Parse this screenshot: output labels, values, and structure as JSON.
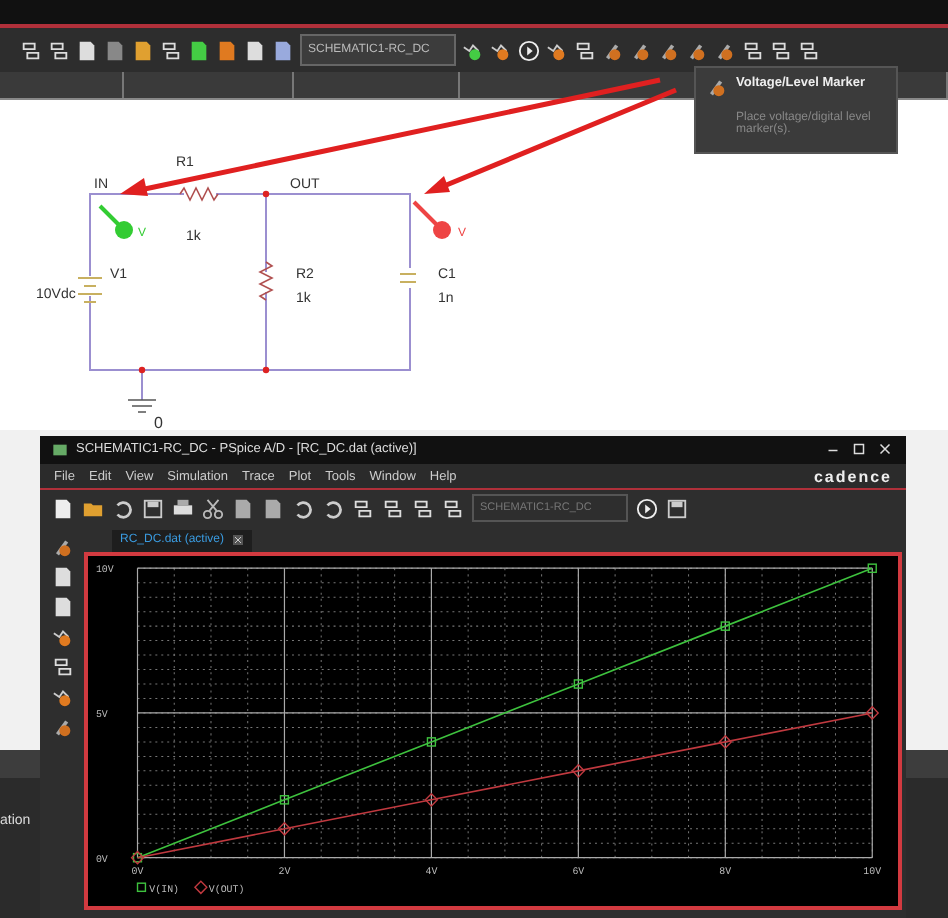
{
  "toolbar": {
    "design_select": "SCHEMATIC1-RC_DC"
  },
  "tooltip": {
    "title": "Voltage/Level Marker",
    "description": "Place voltage/digital level marker(s)."
  },
  "schematic": {
    "nets": [
      "IN",
      "OUT"
    ],
    "parts": [
      {
        "kind": "resistor",
        "ref": "R1",
        "value": "1k"
      },
      {
        "kind": "source",
        "ref": "V1",
        "value": "10Vdc"
      },
      {
        "kind": "resistor",
        "ref": "R2",
        "value": "1k"
      },
      {
        "kind": "capacitor",
        "ref": "C1",
        "value": "1n"
      }
    ],
    "ground": "0",
    "markers": [
      {
        "label": "V",
        "color": "#33cc33"
      },
      {
        "label": "V",
        "color": "#ee4444"
      }
    ]
  },
  "pspice_window": {
    "title": "SCHEMATIC1-RC_DC - PSpice A/D  - [RC_DC.dat (active)]",
    "menu": [
      "File",
      "Edit",
      "View",
      "Simulation",
      "Trace",
      "Plot",
      "Tools",
      "Window",
      "Help"
    ],
    "logo": "cadence",
    "toolbar_field": "SCHEMATIC1-RC_DC",
    "tab": {
      "label": "RC_DC.dat (active)"
    },
    "chart_data": {
      "type": "line",
      "x": [
        0,
        2,
        4,
        6,
        8,
        10
      ],
      "series": [
        {
          "name": "V(IN)",
          "color": "#3ec23e",
          "marker": "square",
          "values": [
            0,
            2,
            4,
            6,
            8,
            10
          ]
        },
        {
          "name": "V(OUT)",
          "color": "#c0393f",
          "marker": "diamond",
          "values": [
            0,
            1,
            2,
            3,
            4,
            5
          ]
        }
      ],
      "grid": true,
      "legend": "bottom",
      "xlim": [
        0,
        10
      ],
      "ylim": [
        0,
        10
      ],
      "xticks": [
        {
          "value": 0,
          "label": "0V"
        },
        {
          "value": 2,
          "label": "2V"
        },
        {
          "value": 4,
          "label": "4V"
        },
        {
          "value": 6,
          "label": "6V"
        },
        {
          "value": 8,
          "label": "8V"
        },
        {
          "value": 10,
          "label": "10V"
        }
      ],
      "yticks": [
        {
          "value": 0,
          "label": "0V"
        },
        {
          "value": 5,
          "label": "5V"
        },
        {
          "value": 10,
          "label": "10V"
        }
      ]
    }
  },
  "side_panel": {
    "label": "ation"
  }
}
